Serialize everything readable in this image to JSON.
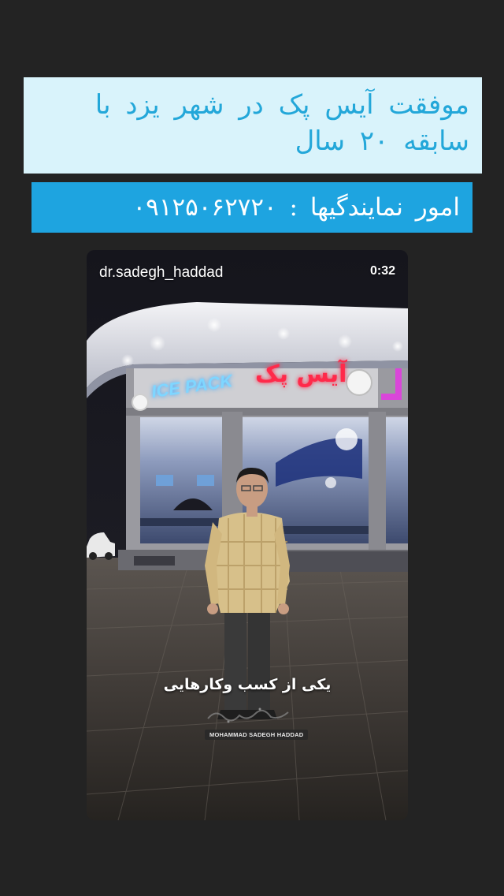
{
  "headline": {
    "text": "موفقت آیس پک در شهر یزد با سابقه ۲۰ سال"
  },
  "phone_banner": {
    "text": "امور نمایندگیها : ۰۹۱۲۵۰۶۲۷۲۰"
  },
  "video": {
    "username": "dr.sadegh_haddad",
    "duration": "0:32",
    "caption": "یکی از کسب وکارهایی",
    "store_sign_latin": "ICE PACK",
    "store_sign_persian": "آیس پک",
    "watermark_label": "MOHAMMAD SADEGH HADDAD"
  },
  "colors": {
    "page_background": "#232323",
    "headline_background": "#d9f3fb",
    "headline_text": "#23a7d9",
    "phone_background": "#1ea4e0",
    "phone_text": "#ffffff",
    "sign_red": "#ff2a4a",
    "sign_blue": "#7fd6ff",
    "sign_magenta": "#e23de0"
  }
}
